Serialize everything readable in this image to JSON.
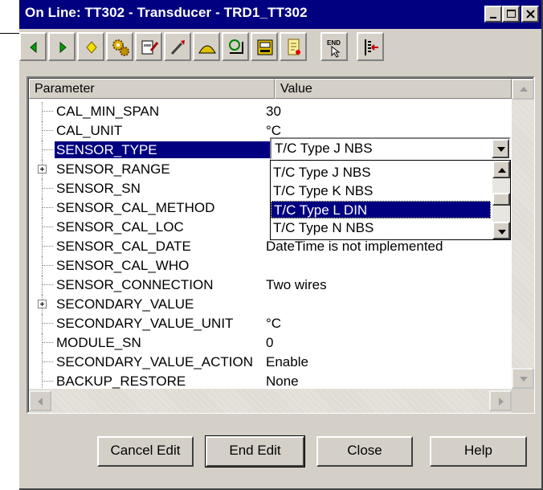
{
  "window": {
    "title": "On Line: TT302 - Transducer - TRD1_TT302"
  },
  "toolbar": {
    "icons": [
      "back-icon",
      "forward-icon",
      "diamond-icon",
      "settings-gears-icon",
      "edit-block-icon",
      "calibrate-icon",
      "curve-icon",
      "trend-icon",
      "display-icon",
      "script-icon",
      "end-edit-icon",
      "list-arrow-icon"
    ]
  },
  "grid": {
    "headers": {
      "parameter": "Parameter",
      "value": "Value"
    },
    "rows": [
      {
        "name": "CAL_MIN_SPAN",
        "value": "30",
        "expandable": false,
        "selected": false
      },
      {
        "name": "CAL_UNIT",
        "value": "°C",
        "expandable": false,
        "selected": false
      },
      {
        "name": "SENSOR_TYPE",
        "value": "",
        "expandable": false,
        "selected": true
      },
      {
        "name": "SENSOR_RANGE",
        "value": "",
        "expandable": true,
        "selected": false
      },
      {
        "name": "SENSOR_SN",
        "value": "",
        "expandable": false,
        "selected": false
      },
      {
        "name": "SENSOR_CAL_METHOD",
        "value": "",
        "expandable": false,
        "selected": false
      },
      {
        "name": "SENSOR_CAL_LOC",
        "value": "",
        "expandable": false,
        "selected": false
      },
      {
        "name": "SENSOR_CAL_DATE",
        "value": "DateTime is not implemented",
        "expandable": false,
        "selected": false
      },
      {
        "name": "SENSOR_CAL_WHO",
        "value": "",
        "expandable": false,
        "selected": false
      },
      {
        "name": "SENSOR_CONNECTION",
        "value": "Two wires",
        "expandable": false,
        "selected": false
      },
      {
        "name": "SECONDARY_VALUE",
        "value": "",
        "expandable": true,
        "selected": false
      },
      {
        "name": "SECONDARY_VALUE_UNIT",
        "value": "°C",
        "expandable": false,
        "selected": false
      },
      {
        "name": "MODULE_SN",
        "value": "0",
        "expandable": false,
        "selected": false
      },
      {
        "name": "SECONDARY_VALUE_ACTION",
        "value": "Enable",
        "expandable": false,
        "selected": false
      },
      {
        "name": "BACKUP_RESTORE",
        "value": "None",
        "expandable": false,
        "selected": false
      }
    ]
  },
  "combo": {
    "value": "T/C Type J NBS",
    "options": [
      "T/C Type J NBS",
      "T/C Type K NBS",
      "T/C Type L DIN",
      "T/C Type N NBS"
    ],
    "highlighted": 2
  },
  "buttons": {
    "cancel_edit": "Cancel Edit",
    "end_edit": "End Edit",
    "close": "Close",
    "help": "Help"
  },
  "colors": {
    "titlebar": "#000080",
    "face": "#d4d0c8",
    "selection": "#000080"
  }
}
